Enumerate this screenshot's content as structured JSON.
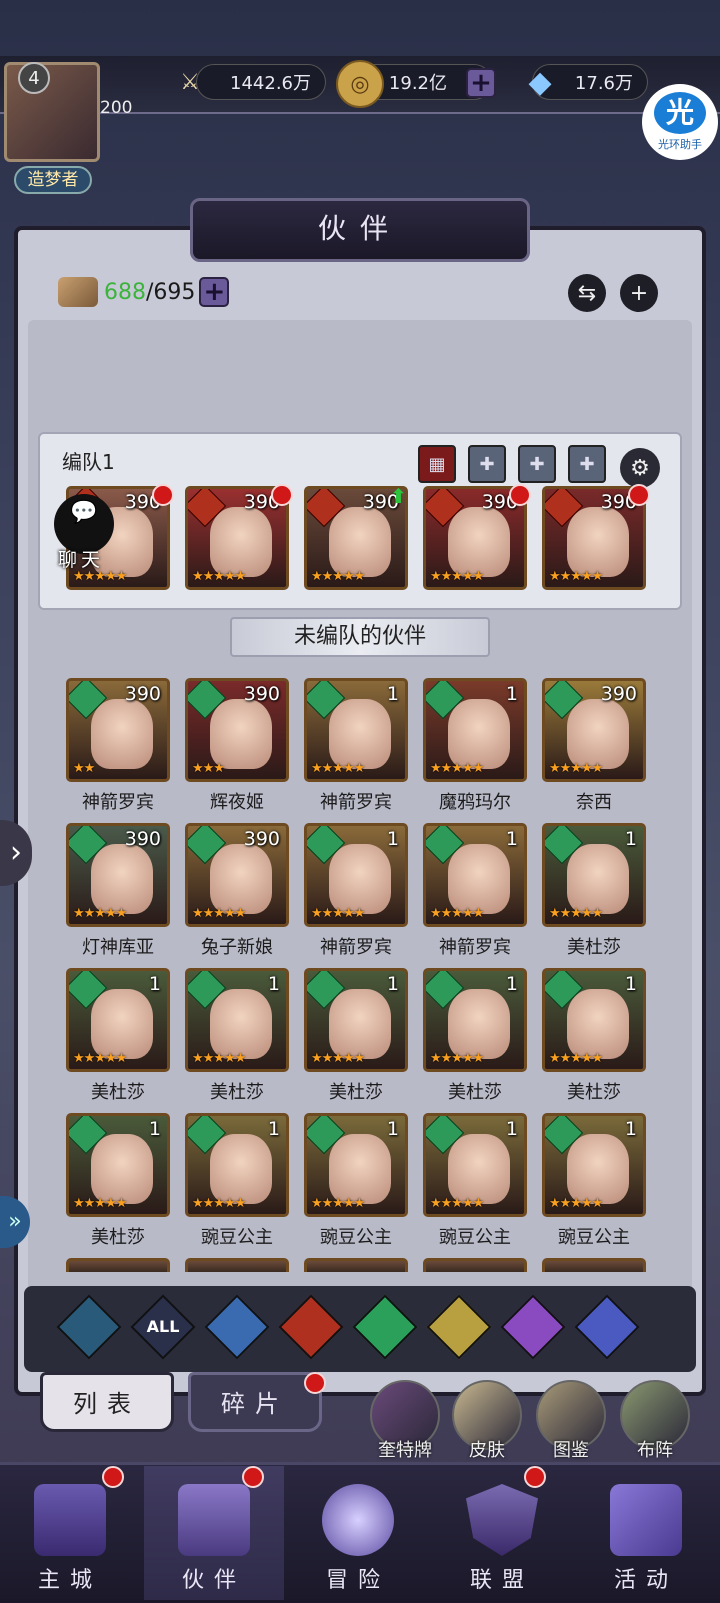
{
  "colors": {
    "accent": "#6a5a9a",
    "level_green": "#3cb43c",
    "badge_red": "#d01818"
  },
  "header": {
    "player_level": "4",
    "player_exp": "200",
    "player_rank": "造梦者",
    "power": "1442.6万",
    "gold": "19.2亿",
    "gems": "17.6万",
    "plus_symbol": "+",
    "helper_glyph": "光",
    "helper_name": "光环助手"
  },
  "page": {
    "title": "伙伴",
    "capacity_current": "688",
    "capacity_sep": "/",
    "capacity_max": "695",
    "swap_icon": "⇆",
    "plus_icon": "+"
  },
  "team": {
    "label": "编队1",
    "chat_label": "聊天",
    "members": [
      {
        "level": "390",
        "stars": "★★★★★",
        "badge": "red"
      },
      {
        "level": "390",
        "stars": "★★★★★",
        "badge": "red"
      },
      {
        "level": "390",
        "stars": "★★★★★",
        "badge": "green-up"
      },
      {
        "level": "390",
        "stars": "★★★★★",
        "badge": "red"
      },
      {
        "level": "390",
        "stars": "★★★★★",
        "badge": "red"
      }
    ]
  },
  "unassigned": {
    "title": "未编队的伙伴",
    "cards": [
      {
        "name": "神箭罗宾",
        "level": "390",
        "stars": "★★"
      },
      {
        "name": "辉夜姬",
        "level": "390",
        "stars": "★★★"
      },
      {
        "name": "神箭罗宾",
        "level": "1",
        "stars": "★★★★★"
      },
      {
        "name": "魔鸦玛尔",
        "level": "1",
        "stars": "★★★★★"
      },
      {
        "name": "奈西",
        "level": "390",
        "stars": "★★★★★"
      },
      {
        "name": "灯神库亚",
        "level": "390",
        "stars": "★★★★★"
      },
      {
        "name": "兔子新娘",
        "level": "390",
        "stars": "★★★★★"
      },
      {
        "name": "神箭罗宾",
        "level": "1",
        "stars": "★★★★★"
      },
      {
        "name": "神箭罗宾",
        "level": "1",
        "stars": "★★★★★"
      },
      {
        "name": "美杜莎",
        "level": "1",
        "stars": "★★★★★"
      },
      {
        "name": "美杜莎",
        "level": "1",
        "stars": "★★★★★"
      },
      {
        "name": "美杜莎",
        "level": "1",
        "stars": "★★★★★"
      },
      {
        "name": "美杜莎",
        "level": "1",
        "stars": "★★★★★"
      },
      {
        "name": "美杜莎",
        "level": "1",
        "stars": "★★★★★"
      },
      {
        "name": "美杜莎",
        "level": "1",
        "stars": "★★★★★"
      },
      {
        "name": "美杜莎",
        "level": "1",
        "stars": "★★★★★"
      },
      {
        "name": "豌豆公主",
        "level": "1",
        "stars": "★★★★★"
      },
      {
        "name": "豌豆公主",
        "level": "1",
        "stars": "★★★★★"
      },
      {
        "name": "豌豆公主",
        "level": "1",
        "stars": "★★★★★"
      },
      {
        "name": "豌豆公主",
        "level": "1",
        "stars": "★★★★★"
      }
    ]
  },
  "filters": {
    "all_label": "ALL",
    "items": [
      "faction-icon",
      "all",
      "water-icon",
      "fire-icon",
      "wind-icon",
      "light-icon",
      "dark-icon",
      "planet-icon"
    ]
  },
  "list_tabs": {
    "list": "列表",
    "fragments": "碎片"
  },
  "sub_buttons": {
    "cards": "奎特牌",
    "skins": "皮肤",
    "codex": "图鉴",
    "formation": "布阵"
  },
  "nav": {
    "city": "主城",
    "partners": "伙伴",
    "adventure": "冒险",
    "alliance": "联盟",
    "events": "活动"
  }
}
